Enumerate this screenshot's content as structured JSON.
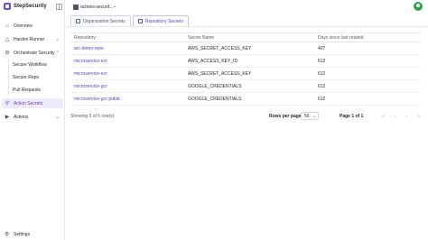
{
  "brand": {
    "name": "StepSecurity",
    "accent": "#5a3fc7"
  },
  "sidebar": {
    "items": [
      {
        "label": "Overview",
        "icon": "home-icon"
      },
      {
        "label": "Harden Runner",
        "icon": "shield-icon"
      },
      {
        "label": "Orchestrate Security",
        "icon": "gear-icon"
      },
      {
        "label": "Secure Workflow"
      },
      {
        "label": "Secure Repo"
      },
      {
        "label": "Pull Requests"
      },
      {
        "label": "Action Secrets",
        "icon": "key-icon"
      },
      {
        "label": "Actions",
        "icon": "play-icon"
      }
    ],
    "settings": {
      "label": "Settings",
      "icon": "gear-icon"
    }
  },
  "topbar": {
    "repo_name": "actions-securit..."
  },
  "tabs": [
    {
      "label": "Organization Secrets"
    },
    {
      "label": "Repository Secrets"
    }
  ],
  "table": {
    "headers": [
      "Repository",
      "Secret Name",
      "Days since last rotated"
    ],
    "rows": [
      {
        "repository": "arc-demo-repo",
        "secret": "AWS_SECRET_ACCESS_KEY",
        "days": "407"
      },
      {
        "repository": "microservice-ecr",
        "secret": "AWS_ACCESS_KEY_ID",
        "days": "612"
      },
      {
        "repository": "microservice-ecr",
        "secret": "AWS_SECRET_ACCESS_KEY",
        "days": "612"
      },
      {
        "repository": "microservice-gcr",
        "secret": "GOOGLE_CREDENTIALS",
        "days": "612"
      },
      {
        "repository": "microservice-gcr-public",
        "secret": "GOOGLE_CREDENTIALS",
        "days": "612"
      }
    ]
  },
  "footer": {
    "showing": "Showing 5 of 5 row(s)",
    "rows_per_page_label": "Rows per page",
    "rows_per_page_value": "50",
    "page_label": "Page 1 of 1"
  }
}
